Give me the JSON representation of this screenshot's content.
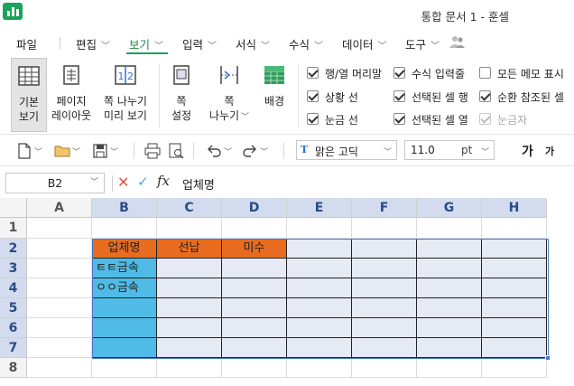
{
  "window": {
    "title": "통합 문서 1 - 훈셀"
  },
  "menu": [
    {
      "label": "파일",
      "caret": false
    },
    {
      "label": "편집",
      "caret": true
    },
    {
      "label": "보기",
      "caret": true,
      "active": true
    },
    {
      "label": "입력",
      "caret": true
    },
    {
      "label": "서식",
      "caret": true
    },
    {
      "label": "수식",
      "caret": true
    },
    {
      "label": "데이터",
      "caret": true
    },
    {
      "label": "도구",
      "caret": true
    }
  ],
  "ribbon": {
    "normal_view": {
      "line1": "기본",
      "line2": "보기"
    },
    "page_layout": {
      "line1": "페이지",
      "line2": "레이아웃"
    },
    "page_break_preview": {
      "line1": "쪽 나누기",
      "line2": "미리 보기"
    },
    "page_setup": {
      "line1": "쪽",
      "line2": "설정"
    },
    "page_break": {
      "line1": "쪽",
      "line2": "나누기"
    },
    "background": {
      "label": "배경"
    },
    "options": [
      {
        "label": "행/열 머리말",
        "checked": true,
        "disabled": false
      },
      {
        "label": "상황 선",
        "checked": true,
        "disabled": false
      },
      {
        "label": "눈금 선",
        "checked": true,
        "disabled": false
      },
      {
        "label": "수식 입력줄",
        "checked": true,
        "disabled": false
      },
      {
        "label": "선택된 셀 행",
        "checked": true,
        "disabled": false
      },
      {
        "label": "선택된 셀 열",
        "checked": true,
        "disabled": false
      },
      {
        "label": "모든 메모 표시",
        "checked": false,
        "disabled": false
      },
      {
        "label": "순환 참조된 셀",
        "checked": true,
        "disabled": false
      },
      {
        "label": "눈금자",
        "checked": true,
        "disabled": true
      }
    ]
  },
  "toolbar": {
    "font_name": "맑은 고딕",
    "font_size": "11.0",
    "size_unit": "pt",
    "font_grow": "가",
    "font_shrink": "가"
  },
  "formula_bar": {
    "cell_ref": "B2",
    "value": "업체명"
  },
  "sheet": {
    "columns": [
      "A",
      "B",
      "C",
      "D",
      "E",
      "F",
      "G",
      "H"
    ],
    "rows": [
      "1",
      "2",
      "3",
      "4",
      "5",
      "6",
      "7",
      "8"
    ],
    "selected_columns": [
      "B",
      "C",
      "D",
      "E",
      "F",
      "G",
      "H"
    ],
    "selected_rows": [
      "2",
      "3",
      "4",
      "5",
      "6",
      "7"
    ],
    "cells": {
      "B2": "업체명",
      "C2": "선납",
      "D2": "미수",
      "B3": "ㅌㅌ금속",
      "B4": "ㅇㅇ금속"
    },
    "colors": {
      "header_fill": "#e86c1f",
      "name_fill": "#4fbbe6",
      "selection": "#4a78c8",
      "accent": "#1aa35b"
    }
  }
}
